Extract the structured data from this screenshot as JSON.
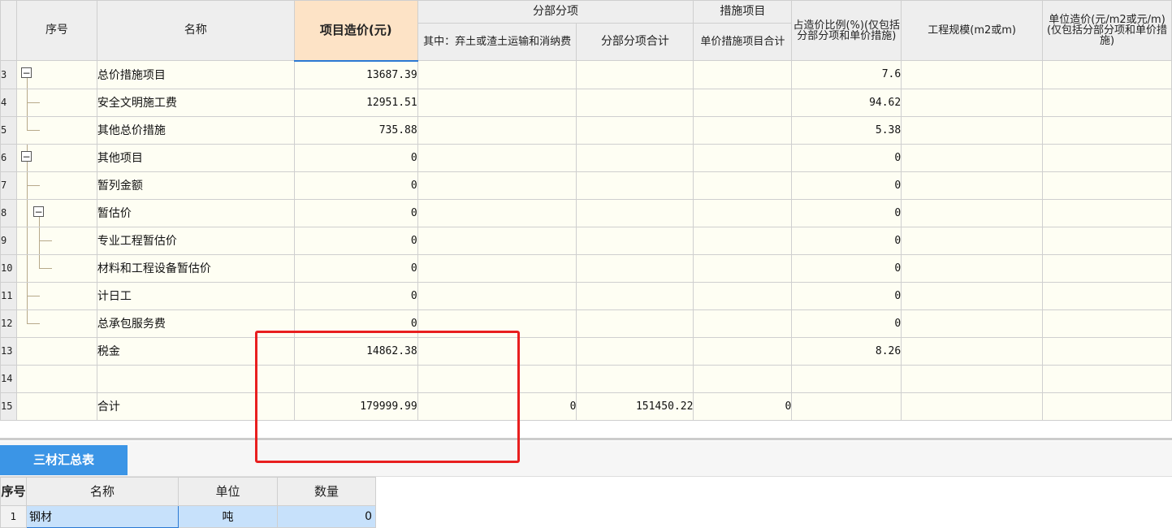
{
  "main_table": {
    "headers": {
      "seq": "序号",
      "name": "名称",
      "project_cost": "项目造价(元)",
      "fenbu_group": "分部分项",
      "fenbu_sub1": "其中：弃土或渣土运输和消纳费",
      "fenbu_sub2": "分部分项合计",
      "cuoshi_group": "措施项目",
      "cuoshi_sub1": "单价措施项目合计",
      "ratio": "占造价比例(%)(仅包括分部分项和单价措施)",
      "scale": "工程规模(m2或m)",
      "unit_cost": "单位造价(元/m2或元/m)(仅包括分部分项和单价措施)"
    },
    "rows": [
      {
        "no": "3",
        "name": "总价措施项目",
        "cost": "13687.39",
        "c1": "",
        "c2": "",
        "c3": "",
        "ratio": "7.6",
        "scale": "",
        "unit": ""
      },
      {
        "no": "4",
        "name": "安全文明施工费",
        "cost": "12951.51",
        "c1": "",
        "c2": "",
        "c3": "",
        "ratio": "94.62",
        "scale": "",
        "unit": ""
      },
      {
        "no": "5",
        "name": "其他总价措施",
        "cost": "735.88",
        "c1": "",
        "c2": "",
        "c3": "",
        "ratio": "5.38",
        "scale": "",
        "unit": ""
      },
      {
        "no": "6",
        "name": "其他项目",
        "cost": "0",
        "c1": "",
        "c2": "",
        "c3": "",
        "ratio": "0",
        "scale": "",
        "unit": ""
      },
      {
        "no": "7",
        "name": "暂列金额",
        "cost": "0",
        "c1": "",
        "c2": "",
        "c3": "",
        "ratio": "0",
        "scale": "",
        "unit": ""
      },
      {
        "no": "8",
        "name": "暂估价",
        "cost": "0",
        "c1": "",
        "c2": "",
        "c3": "",
        "ratio": "0",
        "scale": "",
        "unit": ""
      },
      {
        "no": "9",
        "name": "专业工程暂估价",
        "cost": "0",
        "c1": "",
        "c2": "",
        "c3": "",
        "ratio": "0",
        "scale": "",
        "unit": ""
      },
      {
        "no": "10",
        "name": "材料和工程设备暂估价",
        "cost": "0",
        "c1": "",
        "c2": "",
        "c3": "",
        "ratio": "0",
        "scale": "",
        "unit": ""
      },
      {
        "no": "11",
        "name": "计日工",
        "cost": "0",
        "c1": "",
        "c2": "",
        "c3": "",
        "ratio": "0",
        "scale": "",
        "unit": ""
      },
      {
        "no": "12",
        "name": "总承包服务费",
        "cost": "0",
        "c1": "",
        "c2": "",
        "c3": "",
        "ratio": "0",
        "scale": "",
        "unit": ""
      },
      {
        "no": "13",
        "name": "税金",
        "cost": "14862.38",
        "c1": "",
        "c2": "",
        "c3": "",
        "ratio": "8.26",
        "scale": "",
        "unit": ""
      },
      {
        "no": "14",
        "name": "",
        "cost": "",
        "c1": "",
        "c2": "",
        "c3": "",
        "ratio": "",
        "scale": "",
        "unit": ""
      },
      {
        "no": "15",
        "name": "合计",
        "cost": "179999.99",
        "c1": "0",
        "c2": "151450.22",
        "c3": "0",
        "ratio": "",
        "scale": "",
        "unit": ""
      }
    ],
    "collapse_symbol": "−",
    "edit_icon": "pencil-icon"
  },
  "tabs": {
    "summary": "三材汇总表"
  },
  "sub_table": {
    "headers": {
      "seq": "序号",
      "name": "名称",
      "unit": "单位",
      "qty": "数量"
    },
    "rows": [
      {
        "no": "1",
        "name": "钢材",
        "unit": "吨",
        "qty": "0"
      }
    ]
  },
  "colors": {
    "accent": "#3b95e6",
    "highlight": "#e81f1f",
    "cell_bg": "#fefef3",
    "selected_header": "#fde3c6"
  }
}
